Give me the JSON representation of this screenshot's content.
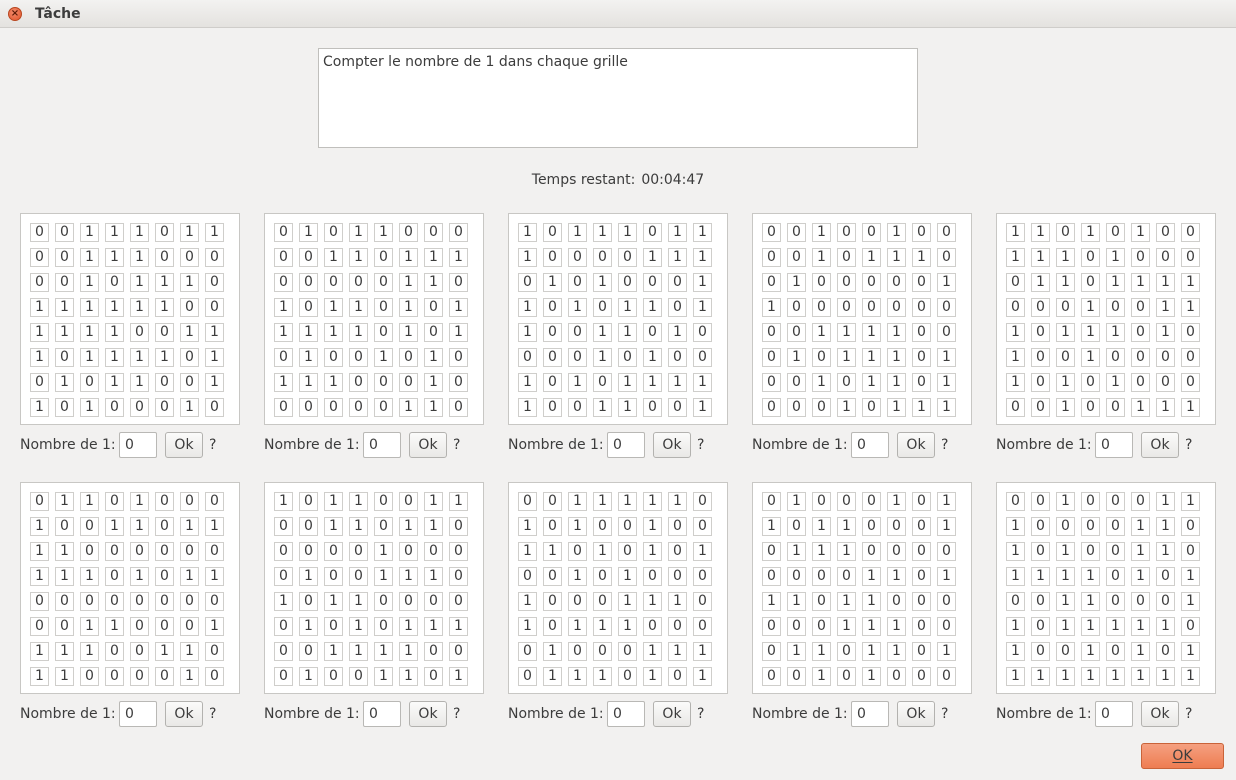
{
  "window": {
    "title": "Tâche",
    "close_glyph": "×"
  },
  "instructions": "Compter le nombre de 1 dans chaque grille",
  "timer": {
    "label": "Temps restant:",
    "value": "00:04:47"
  },
  "answer_label": "Nombre de 1:",
  "ok_small_label": "Ok",
  "question_mark": "?",
  "ok_main_label": "OK",
  "grids": [
    {
      "rows": [
        "00111011",
        "00111000",
        "00101110",
        "11111100",
        "11110011",
        "10111101",
        "01011001",
        "10100010"
      ],
      "answer": "0"
    },
    {
      "rows": [
        "01011000",
        "00110111",
        "00000110",
        "10110101",
        "11110101",
        "01001010",
        "11100010",
        "00000110"
      ],
      "answer": "0"
    },
    {
      "rows": [
        "10111011",
        "10000111",
        "01010001",
        "10101101",
        "10011010",
        "00010100",
        "10101111",
        "10011001"
      ],
      "answer": "0"
    },
    {
      "rows": [
        "00100100",
        "00101110",
        "01000001",
        "10000000",
        "00111100",
        "01011101",
        "00101101",
        "00010111"
      ],
      "answer": "0"
    },
    {
      "rows": [
        "11010100",
        "11101000",
        "01101111",
        "00010011",
        "10111010",
        "10010000",
        "10101000",
        "00100111"
      ],
      "answer": "0"
    },
    {
      "rows": [
        "01101000",
        "10011011",
        "11000000",
        "11101011",
        "00000000",
        "00110001",
        "11100110",
        "11000010"
      ],
      "answer": "0"
    },
    {
      "rows": [
        "10110011",
        "00110110",
        "00001000",
        "01001110",
        "10110000",
        "01010111",
        "00111100",
        "01001101"
      ],
      "answer": "0"
    },
    {
      "rows": [
        "00111110",
        "10100100",
        "11010101",
        "00101000",
        "10001110",
        "10111000",
        "01000111",
        "01110101"
      ],
      "answer": "0"
    },
    {
      "rows": [
        "01000101",
        "10110001",
        "01110000",
        "00001101",
        "11011000",
        "00011100",
        "01101101",
        "00101000"
      ],
      "answer": "0"
    },
    {
      "rows": [
        "00100011",
        "10000110",
        "10100110",
        "11110101",
        "00110001",
        "10111110",
        "10010101",
        "11111111"
      ],
      "answer": "0"
    }
  ]
}
